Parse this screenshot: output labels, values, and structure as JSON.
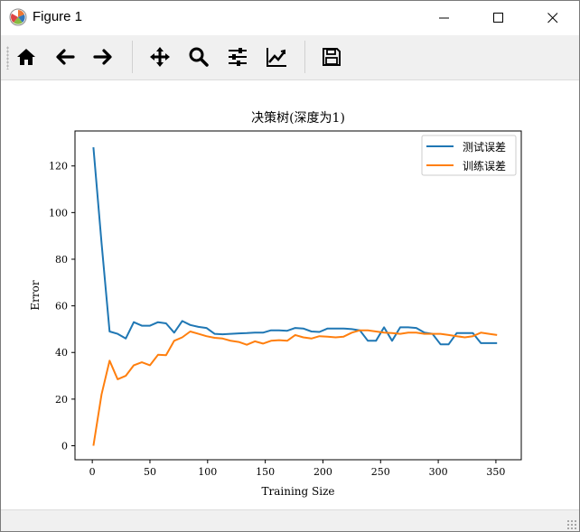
{
  "window": {
    "title": "Figure 1",
    "accent_color": "#1f77b4"
  },
  "toolbar": {
    "buttons": [
      {
        "name": "home-button",
        "icon": "home-icon"
      },
      {
        "name": "back-button",
        "icon": "arrow-left-icon"
      },
      {
        "name": "forward-button",
        "icon": "arrow-right-icon"
      },
      {
        "name": "pan-button",
        "icon": "move-icon"
      },
      {
        "name": "zoom-button",
        "icon": "magnifier-icon"
      },
      {
        "name": "subplots-button",
        "icon": "sliders-icon"
      },
      {
        "name": "edit-axes-button",
        "icon": "line-chart-icon"
      },
      {
        "name": "save-button",
        "icon": "floppy-icon"
      }
    ]
  },
  "chart_data": {
    "type": "line",
    "title": "决策树(深度为1)",
    "xlabel": "Training Size",
    "ylabel": "Error",
    "xlim": [
      -15,
      372
    ],
    "ylim": [
      -6,
      135
    ],
    "xticks": [
      0,
      50,
      100,
      150,
      200,
      250,
      300,
      350
    ],
    "yticks": [
      0,
      20,
      40,
      60,
      80,
      100,
      120
    ],
    "grid": false,
    "legend_position": "top-right",
    "series": [
      {
        "name": "测试误差",
        "color": "#1f77b4",
        "x": [
          1,
          8,
          15,
          22,
          29,
          36,
          43,
          50,
          57,
          64,
          71,
          78,
          85,
          92,
          99,
          106,
          113,
          120,
          127,
          134,
          141,
          148,
          155,
          162,
          169,
          176,
          183,
          190,
          197,
          204,
          211,
          218,
          225,
          232,
          239,
          246,
          253,
          260,
          267,
          274,
          281,
          288,
          295,
          302,
          309,
          316,
          323,
          330,
          337,
          344,
          351
        ],
        "values": [
          128,
          87,
          49,
          48,
          46,
          53,
          51.5,
          51.5,
          53,
          52.5,
          48.5,
          53.5,
          51.8,
          51,
          50.5,
          48,
          47.8,
          48,
          48.2,
          48.3,
          48.5,
          48.5,
          49.5,
          49.5,
          49.3,
          50.5,
          50.3,
          49,
          48.8,
          50.3,
          50.3,
          50.3,
          50,
          49.5,
          45,
          45,
          50.8,
          45,
          50.8,
          50.8,
          50.5,
          48.5,
          48,
          43.5,
          43.5,
          48.3,
          48.3,
          48.3,
          44,
          44,
          44
        ]
      },
      {
        "name": "训练误差",
        "color": "#ff7f0e",
        "x": [
          1,
          8,
          15,
          22,
          29,
          36,
          43,
          50,
          57,
          64,
          71,
          78,
          85,
          92,
          99,
          106,
          113,
          120,
          127,
          134,
          141,
          148,
          155,
          162,
          169,
          176,
          183,
          190,
          197,
          204,
          211,
          218,
          225,
          232,
          239,
          246,
          253,
          260,
          267,
          274,
          281,
          288,
          295,
          302,
          309,
          316,
          323,
          330,
          337,
          344,
          351
        ],
        "values": [
          0,
          22,
          36.5,
          28.5,
          30,
          34.5,
          35.8,
          34.5,
          39,
          38.8,
          45,
          46.5,
          49,
          48,
          47,
          46.3,
          46,
          45,
          44.5,
          43.3,
          44.8,
          43.8,
          45,
          45.3,
          45,
          47.5,
          46.5,
          46,
          47,
          46.8,
          46.5,
          46.8,
          48.5,
          49.5,
          49.5,
          49,
          48.5,
          48.3,
          48,
          48.5,
          48.5,
          48,
          48,
          48,
          47.5,
          47,
          46.5,
          47,
          48.5,
          48,
          47.5
        ]
      }
    ]
  }
}
